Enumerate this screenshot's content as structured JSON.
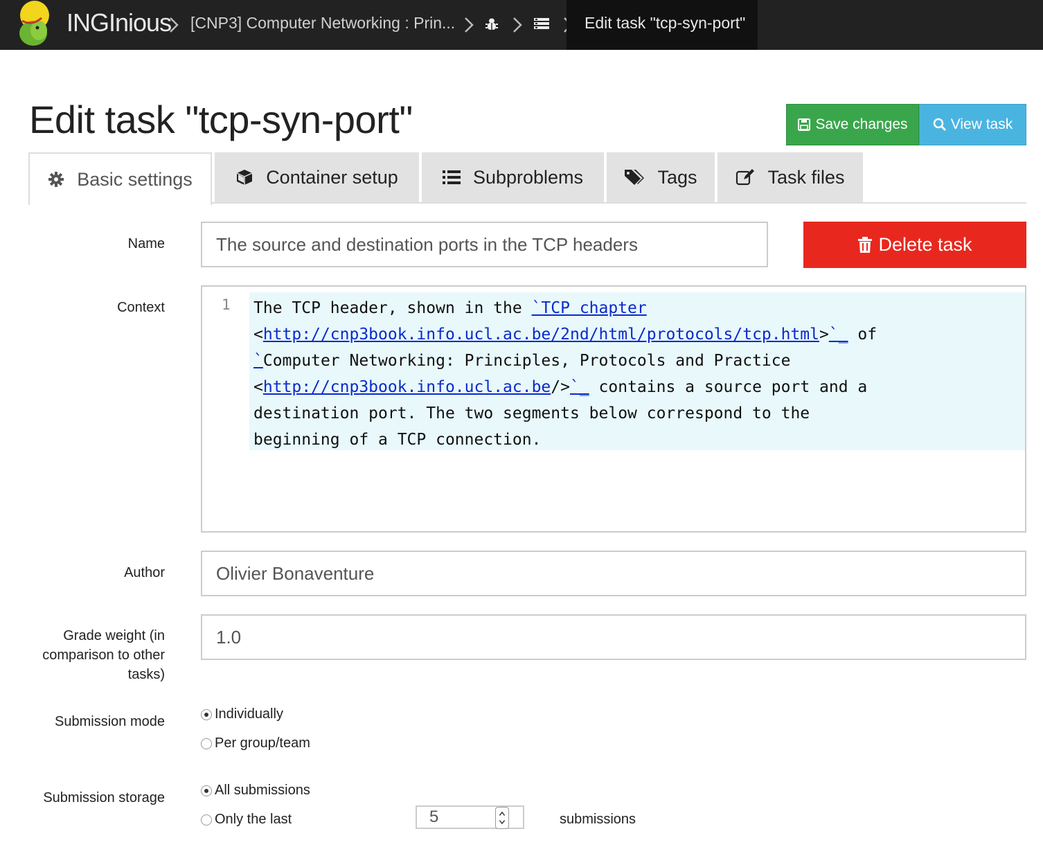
{
  "navbar": {
    "brand": "INGInious",
    "breadcrumbs": [
      {
        "label": "[CNP3] Computer Networking : Prin...",
        "icon": "text"
      },
      {
        "label": "",
        "icon": "bug-icon"
      },
      {
        "label": "",
        "icon": "list-icon"
      }
    ],
    "active_crumb": "Edit task \"tcp-syn-port\""
  },
  "page": {
    "title": "Edit task \"tcp-syn-port\"",
    "save_label": "Save changes",
    "view_label": "View task"
  },
  "tabs": [
    {
      "label": "Basic settings",
      "icon": "gear-icon",
      "active": true
    },
    {
      "label": "Container setup",
      "icon": "cube-icon",
      "active": false
    },
    {
      "label": "Subproblems",
      "icon": "list-icon",
      "active": false
    },
    {
      "label": "Tags",
      "icon": "tags-icon",
      "active": false
    },
    {
      "label": "Task files",
      "icon": "edit-icon",
      "active": false
    }
  ],
  "form": {
    "name_label": "Name",
    "name_value": "The source and destination ports in the TCP headers",
    "delete_label": "Delete task",
    "context_label": "Context",
    "context_line_number": "1",
    "context": {
      "l1": "The TCP header, shown in the ",
      "l1b": "`TCP chapter",
      "l2a": "<",
      "l2link": "http://cnp3book.info.ucl.ac.be/2nd/html/protocols/tcp.html",
      "l2b": ">",
      "l2c": "`_",
      "l2d": " of",
      "l3a": "`",
      "l3b": "Computer Networking: Principles, Protocols and Practice",
      "l4a": "<",
      "l4link": "http://cnp3book.info.ucl.ac.be",
      "l4b": "/>",
      "l4c": "`_",
      "l4d": " contains a source port and a",
      "l5": "destination port. The two segments below correspond to the",
      "l6": "beginning of a TCP connection."
    },
    "author_label": "Author",
    "author_value": "Olivier Bonaventure",
    "grade_label_1": "Grade weight (in",
    "grade_label_2": "comparison to other",
    "grade_label_3": "tasks)",
    "grade_value": "1.0",
    "submission_mode_label": "Submission mode",
    "mode_options": [
      "Individually",
      "Per group/team"
    ],
    "mode_selected": "Individually",
    "submission_storage_label": "Submission storage",
    "storage_options": [
      "All submissions",
      "Only the last"
    ],
    "storage_selected": "All submissions",
    "storage_count": "5",
    "storage_suffix": "submissions"
  },
  "colors": {
    "navbar": "#222222",
    "save": "#3aa64c",
    "view": "#4ab4e0",
    "delete": "#e8281f",
    "editor_highlight": "#e8f8fb"
  }
}
